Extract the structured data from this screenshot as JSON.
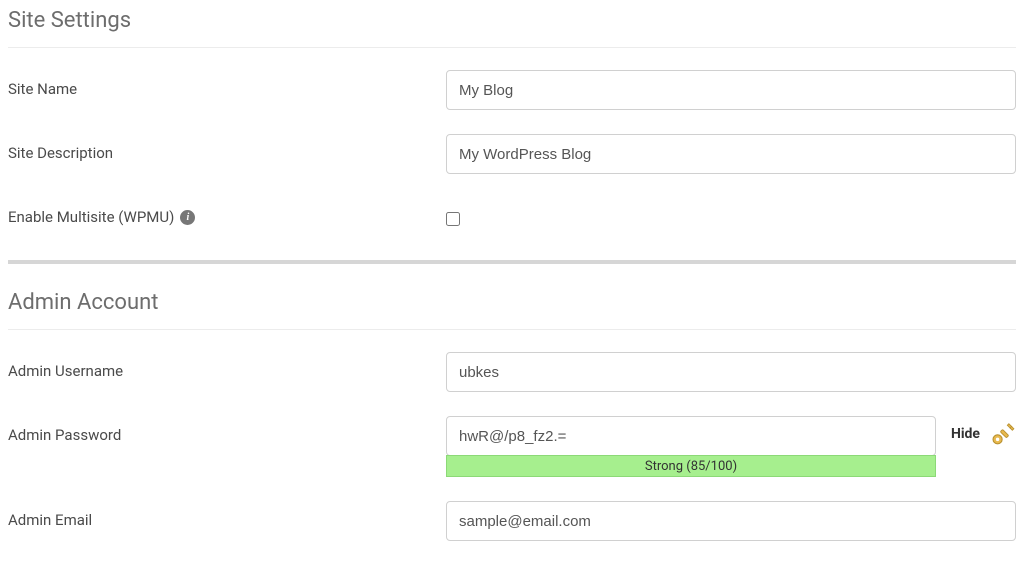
{
  "siteSettings": {
    "heading": "Site Settings",
    "siteName": {
      "label": "Site Name",
      "value": "My Blog"
    },
    "siteDescription": {
      "label": "Site Description",
      "value": "My WordPress Blog"
    },
    "multisite": {
      "label": "Enable Multisite (WPMU)",
      "checked": false
    }
  },
  "adminAccount": {
    "heading": "Admin Account",
    "username": {
      "label": "Admin Username",
      "value": "ubkes"
    },
    "password": {
      "label": "Admin Password",
      "value": "hwR@/p8_fz2.=",
      "toggleLabel": "Hide",
      "strengthText": "Strong (85/100)"
    },
    "email": {
      "label": "Admin Email",
      "value": "sample@email.com"
    }
  }
}
